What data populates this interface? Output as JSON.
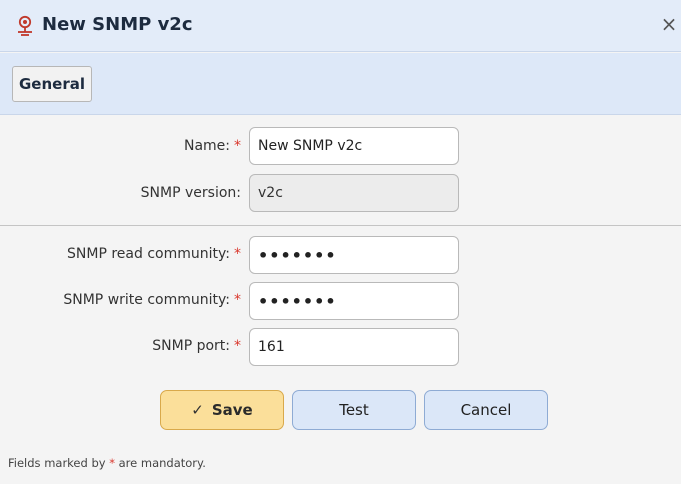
{
  "window": {
    "title": "New SNMP v2c",
    "title_icon": "snmp-network-icon",
    "close_glyph": "×"
  },
  "tabs": [
    {
      "label": "General",
      "active": true
    }
  ],
  "form": {
    "name": {
      "label": "Name:",
      "required_marker": "*",
      "value": "New SNMP v2c"
    },
    "snmp_version": {
      "label": "SNMP version:",
      "value": "v2c",
      "readonly": true
    },
    "read_community": {
      "label": "SNMP read community:",
      "required_marker": "*",
      "value": "•••••••"
    },
    "write_community": {
      "label": "SNMP write community:",
      "required_marker": "*",
      "value": "•••••••"
    },
    "port": {
      "label": "SNMP port:",
      "required_marker": "*",
      "value": "161"
    }
  },
  "buttons": {
    "save": {
      "label": "Save",
      "icon": "checkmark-icon"
    },
    "test": {
      "label": "Test"
    },
    "cancel": {
      "label": "Cancel"
    }
  },
  "footnote": {
    "prefix": "Fields marked by ",
    "marker": "*",
    "suffix": " are mandatory."
  },
  "colors": {
    "header_bg": "#e3ecf9",
    "tabbar_bg": "#dde8f8",
    "required_marker": "#d9362b",
    "save_bg": "#fbdf9a",
    "secondary_btn_bg": "#dbe7f8"
  }
}
